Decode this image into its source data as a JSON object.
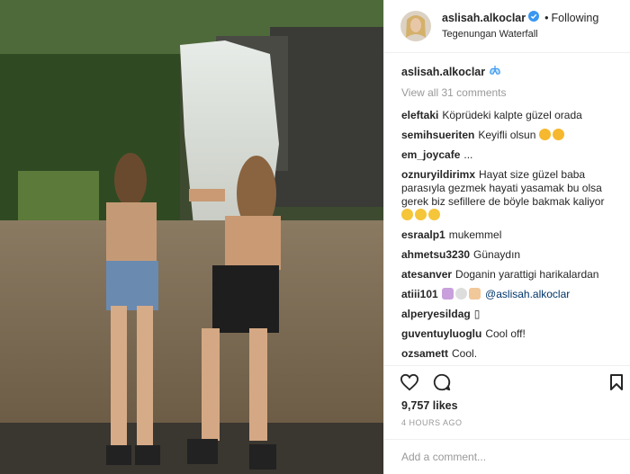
{
  "header": {
    "username": "aslisah.alkoclar",
    "separator": "•",
    "follow_label": "Following",
    "location": "Tegenungan Waterfall"
  },
  "caption": {
    "username": "aslisah.alkoclar",
    "emoji_icon": "lungs-emoji"
  },
  "view_all": "View all 31 comments",
  "comments": [
    {
      "user": "eleftaki",
      "text": "Köprüdeki kalpte güzel orada"
    },
    {
      "user": "semihsueriten",
      "text": "Keyifli olsun"
    },
    {
      "user": "em_joycafe",
      "text": "..."
    },
    {
      "user": "oznuryildirimx",
      "text": "Hayat size güzel baba parasıyla gezmek hayati yasamak bu olsa gerek biz sefillere de böyle bakmak kaliyor"
    },
    {
      "user": "esraalp1",
      "text": "mukemmel"
    },
    {
      "user": "ahmetsu3230",
      "text": "Günaydın"
    },
    {
      "user": "atesanver",
      "text": "Doganin yarattigi harikalardan"
    },
    {
      "user": "atiii101",
      "text": "@aslisah.alkoclar"
    },
    {
      "user": "alperyesildag",
      "text": "▯"
    },
    {
      "user": "guventuyluoglu",
      "text": "Cool off!"
    },
    {
      "user": "ozsamett",
      "text": "Cool."
    }
  ],
  "likes": "9,757 likes",
  "time": "4 HOURS AGO",
  "add_comment": {
    "placeholder": "Add a comment..."
  },
  "colors": {
    "verified": "#3897f0",
    "mention": "#003569",
    "muted": "#999999"
  }
}
